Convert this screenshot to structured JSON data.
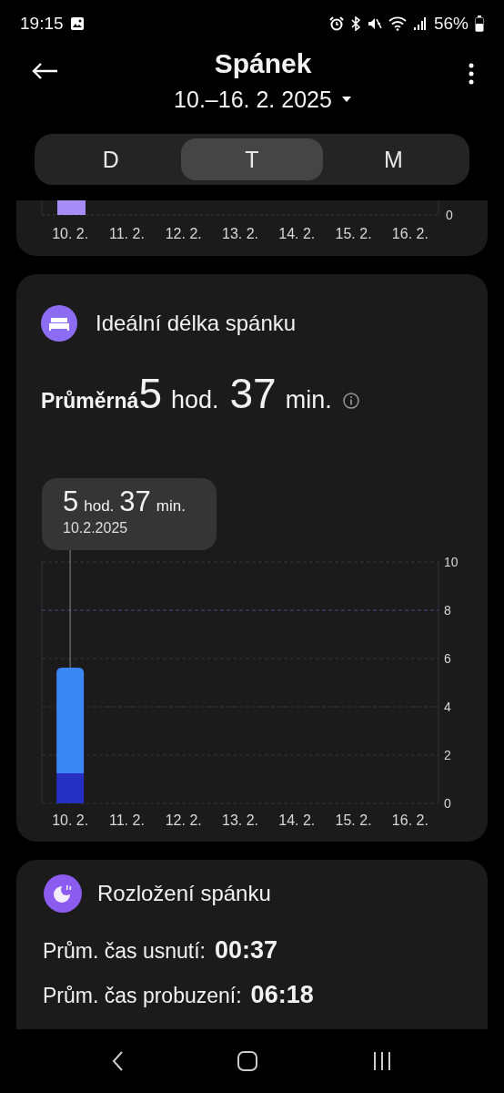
{
  "status_bar": {
    "time": "19:15",
    "battery": "56%"
  },
  "header": {
    "title": "Spánek",
    "date_range": "10.–16. 2. 2025"
  },
  "period_tabs": [
    {
      "label": "D",
      "selected": false
    },
    {
      "label": "T",
      "selected": true
    },
    {
      "label": "M",
      "selected": false
    }
  ],
  "previous_card": {
    "y_tick": "0",
    "x_labels": [
      "10. 2.",
      "11. 2.",
      "12. 2.",
      "13. 2.",
      "14. 2.",
      "15. 2.",
      "16. 2."
    ]
  },
  "ideal_length_card": {
    "title": "Ideální délka spánku",
    "average": {
      "label": "Průměrná",
      "hours": "5",
      "hours_unit": "hod.",
      "minutes": "37",
      "minutes_unit": "min."
    },
    "tooltip": {
      "hours": "5",
      "hours_unit": "hod.",
      "minutes": "37",
      "minutes_unit": "min.",
      "date": "10.2.2025"
    },
    "chart_data": {
      "type": "bar",
      "stacked": true,
      "categories": [
        "10. 2.",
        "11. 2.",
        "12. 2.",
        "13. 2.",
        "14. 2.",
        "15. 2.",
        "16. 2."
      ],
      "series": [
        {
          "color": "#2530c2",
          "values": [
            1.25,
            null,
            null,
            null,
            null,
            null,
            null
          ]
        },
        {
          "color": "#3b87f5",
          "values": [
            4.37,
            null,
            null,
            null,
            null,
            null,
            null
          ]
        }
      ],
      "ylim": [
        0,
        10
      ],
      "yticks": [
        0,
        2,
        4,
        6,
        8,
        10
      ],
      "grid": true,
      "ref_lines": [
        {
          "axis": "y",
          "value": 8,
          "color": "#4a4a86"
        }
      ]
    }
  },
  "distribution_card": {
    "title": "Rozložení spánku",
    "rows": [
      {
        "label": "Prům. čas usnutí:",
        "value": "00:37"
      },
      {
        "label": "Prům. čas probuzení:",
        "value": "06:18"
      }
    ]
  }
}
